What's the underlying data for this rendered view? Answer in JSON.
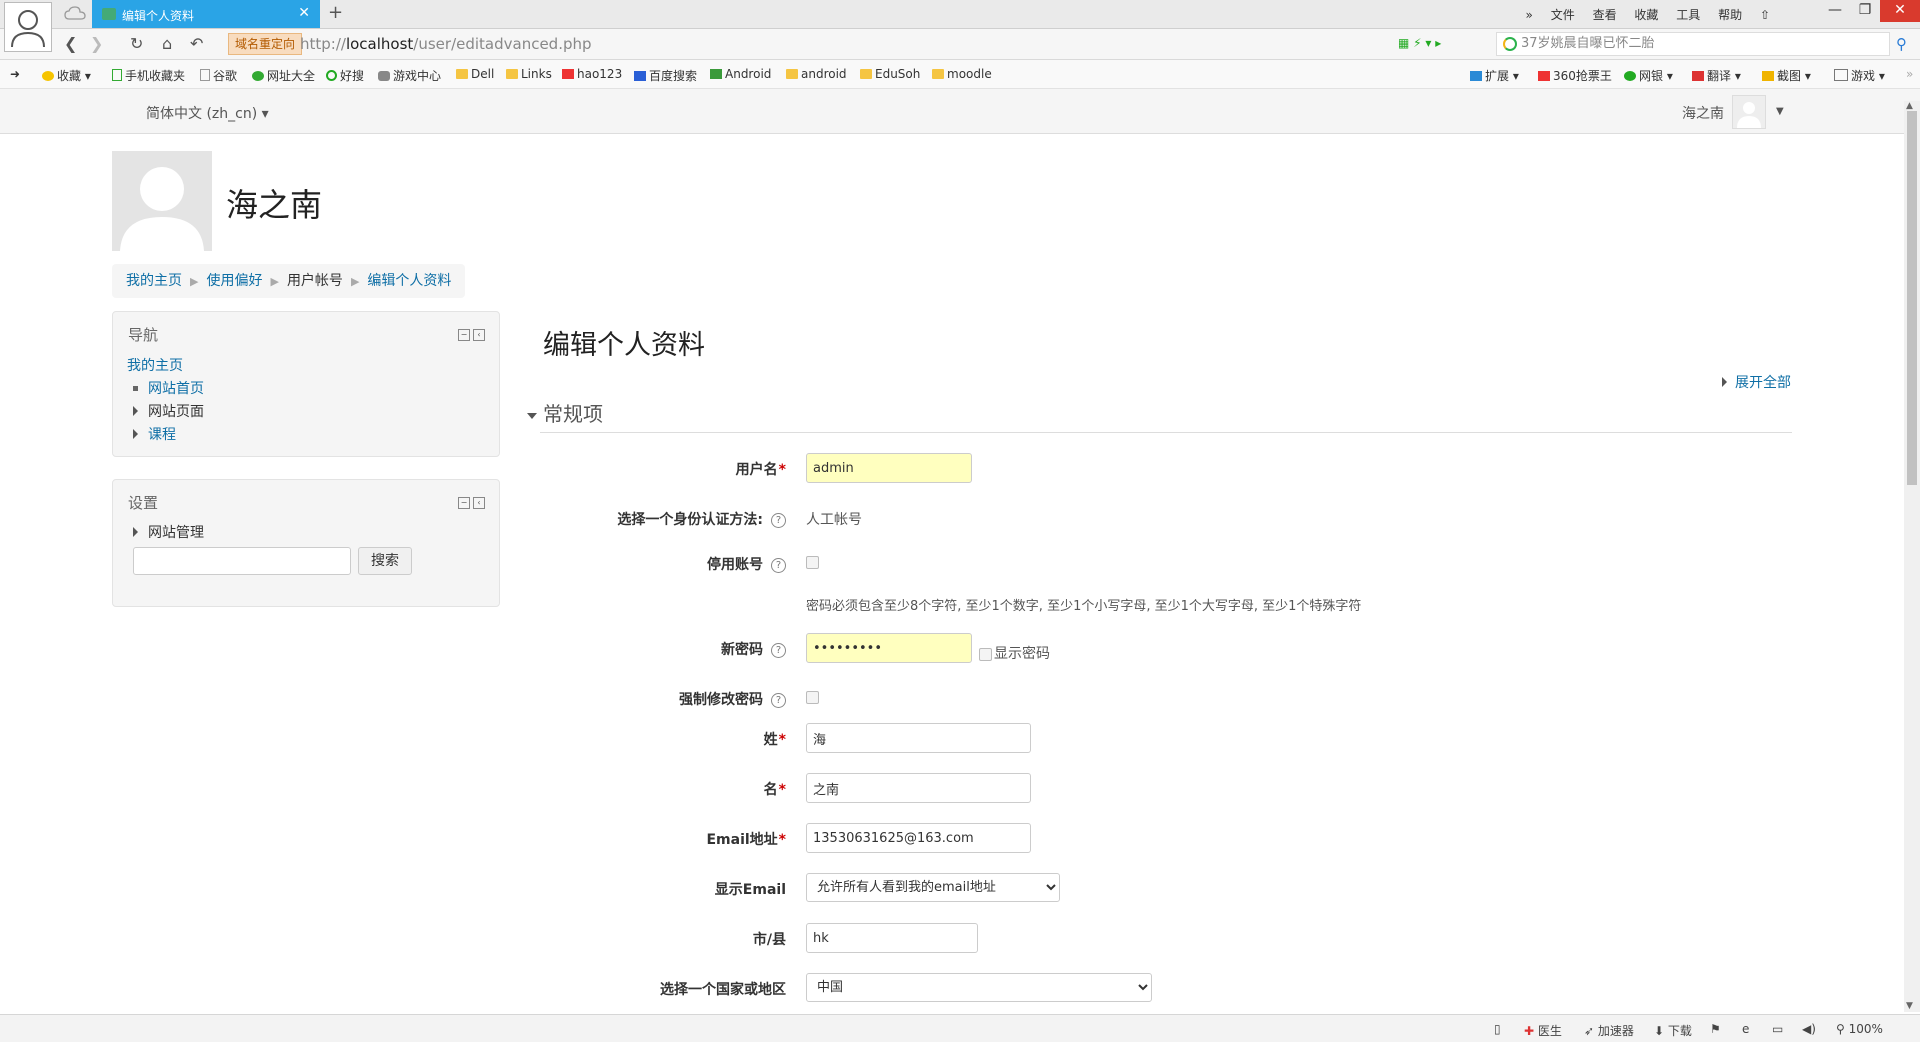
{
  "browser": {
    "tab_title": "编辑个人资料",
    "topmenu": [
      "»",
      "文件",
      "查看",
      "收藏",
      "工具",
      "帮助"
    ],
    "redirect_label": "域名重定向",
    "url_prefix": "http://",
    "url_host": "localhost",
    "url_path": "/user/editadvanced.php",
    "search_text": "37岁姚晨自曝已怀二胎",
    "bookmarks": [
      "收藏",
      "手机收藏夹",
      "谷歌",
      "网址大全",
      "好搜",
      "游戏中心",
      "Dell",
      "Links",
      "hao123",
      "百度搜索",
      "Android",
      "android",
      "EduSoh",
      "moodle"
    ],
    "right_tools": [
      "扩展",
      "360抢票王",
      "网银",
      "翻译",
      "截图",
      "游戏"
    ],
    "status_items": [
      "医生",
      "加速器",
      "下载",
      "100%"
    ]
  },
  "pagebar": {
    "language": "简体中文 (zh_cn)",
    "user_name": "海之南"
  },
  "header": {
    "name": "海之南",
    "breadcrumb": [
      "我的主页",
      "使用偏好",
      "用户帐号",
      "编辑个人资料"
    ]
  },
  "nav_block": {
    "title": "导航",
    "home": "我的主页",
    "items": [
      "网站首页",
      "网站页面",
      "课程"
    ]
  },
  "settings_block": {
    "title": "设置",
    "item": "网站管理",
    "search_button": "搜索"
  },
  "form": {
    "title": "编辑个人资料",
    "expand_all": "展开全部",
    "section": "常规项",
    "username_label": "用户名",
    "username_value": "admin",
    "auth_label": "选择一个身份认证方法:",
    "auth_value": "人工帐号",
    "suspend_label": "停用账号",
    "password_policy": "密码必须包含至少8个字符, 至少1个数字, 至少1个小写字母, 至少1个大写字母, 至少1个特殊字符",
    "newpassword_label": "新密码",
    "newpassword_value": "•••••••••",
    "show_password": "显示密码",
    "force_change_label": "强制修改密码",
    "lastname_label": "姓",
    "lastname_value": "海",
    "firstname_label": "名",
    "firstname_value": "之南",
    "email_label": "Email地址",
    "email_value": "13530631625@163.com",
    "display_email_label": "显示Email",
    "display_email_value": "允许所有人看到我的email地址",
    "city_label": "市/县",
    "city_value": "hk",
    "country_label": "选择一个国家或地区",
    "country_value": "中国"
  }
}
